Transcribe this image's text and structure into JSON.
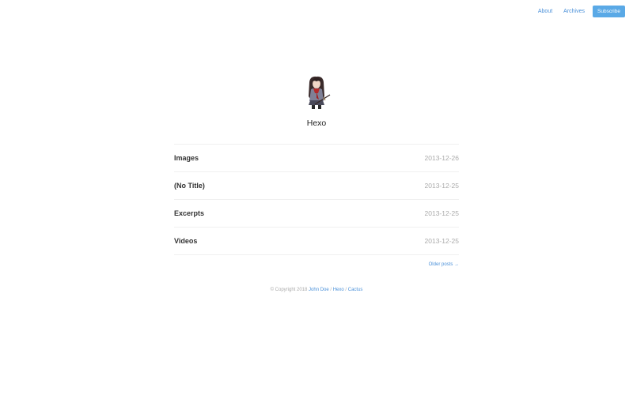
{
  "nav": {
    "about": "About",
    "archives": "Archives",
    "subscribe": "Subscribe"
  },
  "profile": {
    "avatar_icon": "avatar-illustration-icon",
    "title": "Hexo"
  },
  "posts": [
    {
      "title": "Images",
      "date": "2013-12-26"
    },
    {
      "title": "(No Title)",
      "date": "2013-12-25"
    },
    {
      "title": "Excerpts",
      "date": "2013-12-25"
    },
    {
      "title": "Videos",
      "date": "2013-12-25"
    }
  ],
  "pagination": {
    "older": "Older posts →"
  },
  "footer": {
    "copyright": "© Copyright 2018",
    "author": "John Doe",
    "sep1": "/",
    "hexo": "Hexo",
    "sep2": "/",
    "theme": "Cactus"
  },
  "colors": {
    "link": "#4a90d9",
    "button": "#5aa9e6",
    "muted": "#aaaaaa"
  }
}
